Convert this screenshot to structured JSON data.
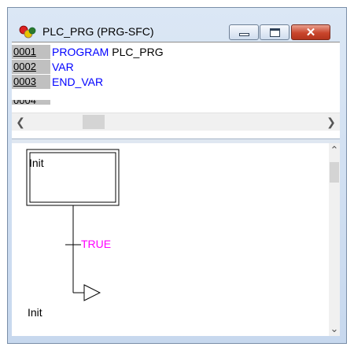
{
  "window": {
    "title": "PLC_PRG (PRG-SFC)",
    "icons": [
      "app-icon",
      "minimize-icon",
      "maximize-icon",
      "close-icon"
    ]
  },
  "declaration": {
    "lines": [
      {
        "number": "0001",
        "keyword": "PROGRAM",
        "identifier": "PLC_PRG"
      },
      {
        "number": "0002",
        "keyword": "VAR",
        "identifier": ""
      },
      {
        "number": "0003",
        "keyword": "END_VAR",
        "identifier": ""
      }
    ],
    "partial_line_number": "0004"
  },
  "sfc": {
    "initial_step": "Init",
    "transition_condition": "TRUE",
    "jump_target": "Init"
  },
  "colors": {
    "keyword": "#0000ff",
    "transition": "#ff00ff",
    "line_number_bg": "#c0c0c0"
  }
}
